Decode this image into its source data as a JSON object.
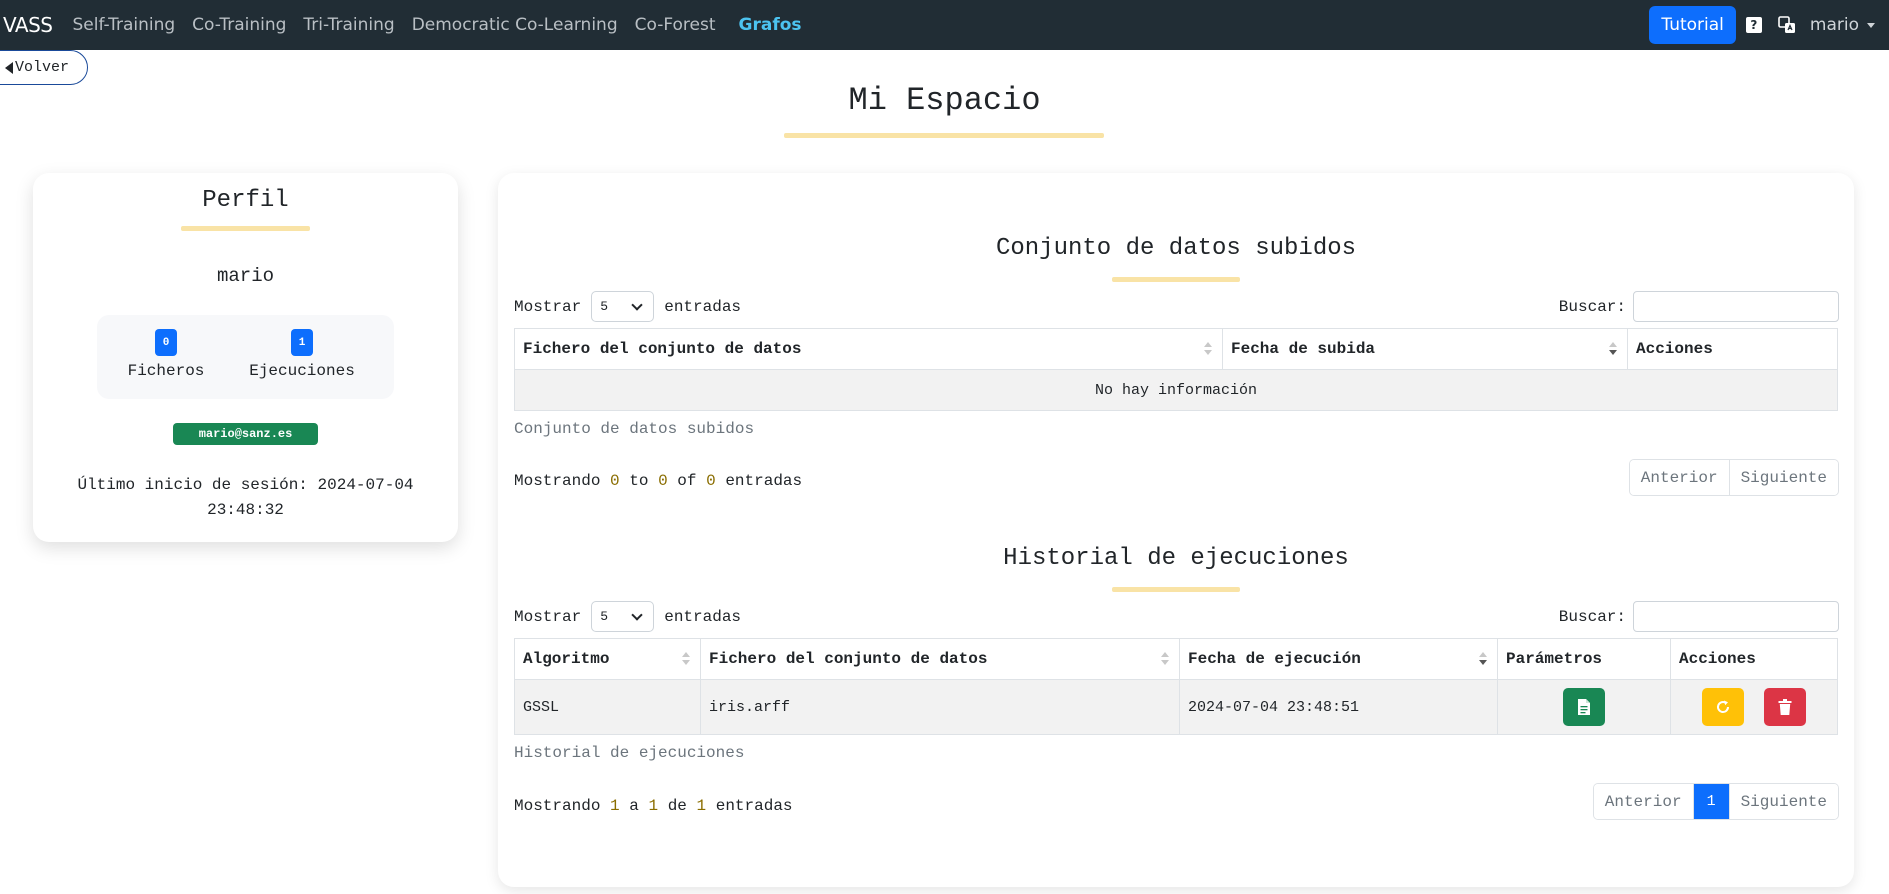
{
  "nav": {
    "brand": "VASS",
    "links": [
      "Self-Training",
      "Co-Training",
      "Tri-Training",
      "Democratic Co-Learning",
      "Co-Forest",
      "Grafos"
    ],
    "tutorial": "Tutorial",
    "help": "?",
    "user": "mario"
  },
  "back": "Volver",
  "page_title": "Mi Espacio",
  "profile": {
    "title": "Perfil",
    "username": "mario",
    "files_count": "0",
    "files_label": "Ficheros",
    "runs_count": "1",
    "runs_label": "Ejecuciones",
    "email": "mario@sanz.es",
    "last_login_label": "Último inicio de sesión: 2024-07-04",
    "last_login_time": "23:48:32"
  },
  "datasets": {
    "title": "Conjunto de datos subidos",
    "show_label": "Mostrar",
    "page_size": "5",
    "entries_label": "entradas",
    "search_label": "Buscar:",
    "columns": [
      "Fichero del conjunto de datos",
      "Fecha de subida",
      "Acciones"
    ],
    "empty": "No hay información",
    "caption": "Conjunto de datos subidos",
    "info": {
      "prefix": "Mostrando",
      "start": "0",
      "to": "to",
      "end": "0",
      "of": "of",
      "total": "0",
      "suffix": "entradas"
    },
    "prev": "Anterior",
    "next": "Siguiente"
  },
  "history": {
    "title": "Historial de ejecuciones",
    "show_label": "Mostrar",
    "page_size": "5",
    "entries_label": "entradas",
    "search_label": "Buscar:",
    "columns": [
      "Algoritmo",
      "Fichero del conjunto de datos",
      "Fecha de ejecución",
      "Parámetros",
      "Acciones"
    ],
    "rows": [
      {
        "algorithm": "GSSL",
        "file": "iris.arff",
        "date": "2024-07-04 23:48:51"
      }
    ],
    "caption": "Historial de ejecuciones",
    "info": {
      "prefix": "Mostrando",
      "start": "1",
      "to": "a",
      "end": "1",
      "of": "de",
      "total": "1",
      "suffix": "entradas"
    },
    "prev": "Anterior",
    "current_page": "1",
    "next": "Siguiente"
  },
  "colors": {
    "navbar": "#212d35",
    "primary": "#0d6efd",
    "success": "#198754",
    "warning": "#ffc107",
    "danger": "#dc3545",
    "accent_underline": "#f9e3a6"
  },
  "icons": [
    "translate-icon",
    "back-arrow-icon",
    "sort-icon",
    "document-icon",
    "rerun-icon",
    "trash-icon"
  ]
}
